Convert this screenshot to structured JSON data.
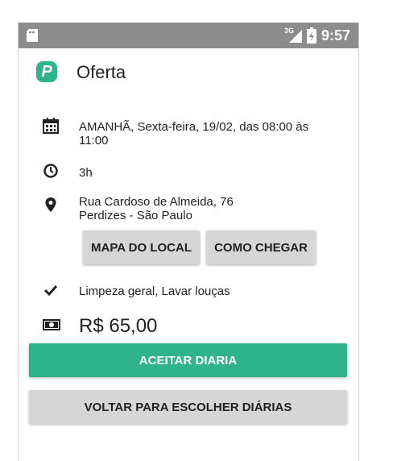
{
  "top_caption": "",
  "status_bar": {
    "network": "3G",
    "time": "9:57",
    "icons": [
      "sim-card-icon",
      "signal-icon",
      "battery-icon"
    ]
  },
  "header": {
    "logo_letter": "P",
    "title": "Oferta"
  },
  "offer": {
    "date_line1": "AMANHÃ, Sexta-feira, 19/02, das 08:00 às",
    "date_line2": "11:00",
    "duration": "3h",
    "address_line1": "Rua Cardoso de Almeida, 76",
    "address_line2": "Perdizes - São Paulo",
    "services": "Limpeza geral, Lavar louças",
    "price": "R$ 65,00"
  },
  "buttons": {
    "map": "MAPA DO LOCAL",
    "directions": "COMO CHEGAR",
    "accept": "ACEITAR DIARIA",
    "back": "VOLTAR PARA ESCOLHER DIÁRIAS"
  },
  "colors": {
    "accent": "#2fb38a",
    "status_bar": "#8c8c8c",
    "button_gray": "#d6d6d6"
  }
}
